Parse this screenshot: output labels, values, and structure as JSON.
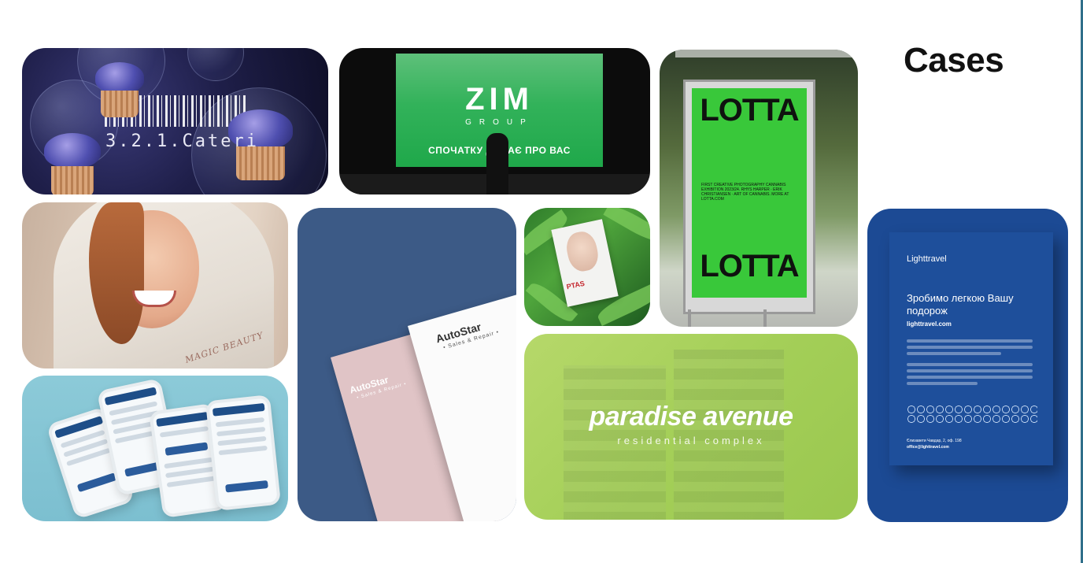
{
  "page": {
    "heading": "Cases"
  },
  "cases": {
    "catering": {
      "text": "3.2.1.Cateri"
    },
    "zim": {
      "logo": "ZIM",
      "sub": "GROUP",
      "tagline": "СПОЧАТКУ ДУМАЄ ПРО ВАС"
    },
    "lotta": {
      "title_top": "LOTTA",
      "title_bottom": "LOTTA",
      "small_text": "FIRST CREATIVE PHOTOGRAPHY CANNABIS EXHIBITION 2023/24. RHYS HARPER · ERIK CHRISTIANSEN · ART OF CANNABIS. MORE AT LOTTA.COM"
    },
    "magic_beauty": {
      "text": "MAGIC BEAUTY"
    },
    "autostar": {
      "white_title": "AutoStar",
      "white_sub": "• Sales & Repair •",
      "pink_title": "AutoStar",
      "pink_sub": "• Sales & Repair •"
    },
    "plant": {
      "title": "PTAS"
    },
    "paradise": {
      "title": "paradise avenue",
      "sub": "residential complex"
    },
    "lighttravel": {
      "logo": "Lighttravel",
      "headline": "Зробимо легкою Вашу подорож",
      "url": "lighttravel.com",
      "address": "Єлизавети Чавдар, 2, оф. 198",
      "email": "office@lighttravel.com"
    }
  }
}
